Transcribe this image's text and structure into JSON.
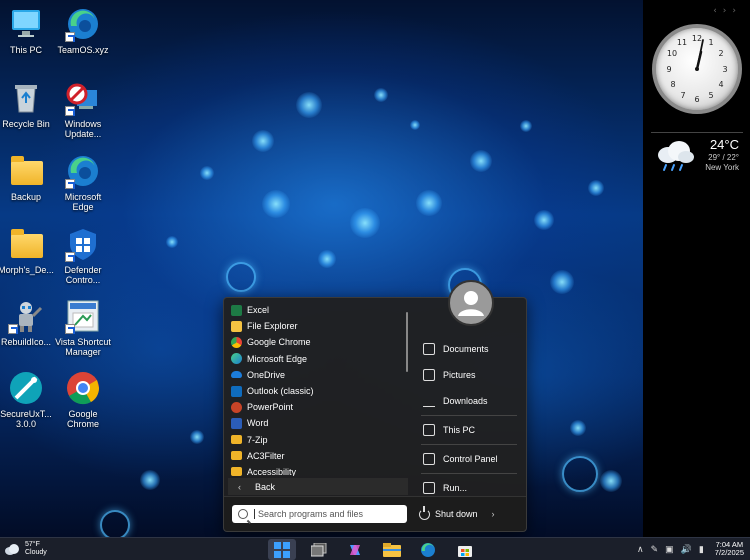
{
  "desktop_icons": [
    {
      "label": "This PC",
      "icon": "this-pc-icon"
    },
    {
      "label": "TeamOS.xyz",
      "icon": "edge-icon"
    },
    {
      "label": "Recycle Bin",
      "icon": "recycle-bin-icon"
    },
    {
      "label": "Windows Update...",
      "icon": "windows-update-icon"
    },
    {
      "label": "Backup",
      "icon": "folder-icon"
    },
    {
      "label": "Microsoft Edge",
      "icon": "edge-icon"
    },
    {
      "label": "Morph's_De...",
      "icon": "folder-icon"
    },
    {
      "label": "Defender Contro...",
      "icon": "defender-icon"
    },
    {
      "label": "RebuildIco...",
      "icon": "robot-icon"
    },
    {
      "label": "Vista Shortcut Manager",
      "icon": "shortcut-manager-icon"
    },
    {
      "label": "SecureUxT... 3.0.0",
      "icon": "secureux-icon"
    },
    {
      "label": "Google Chrome",
      "icon": "chrome-icon"
    }
  ],
  "sidebar": {
    "clock_time": "7:04",
    "weather": {
      "temp": "24°C",
      "range": "29° / 22°",
      "city": "New York",
      "icon": "rain-cloud-icon"
    }
  },
  "start_menu": {
    "programs": [
      {
        "label": "Excel",
        "icon": "excel-icon",
        "color": "#1d7a45"
      },
      {
        "label": "File Explorer",
        "icon": "file-explorer-icon",
        "color": "#f5c242"
      },
      {
        "label": "Google Chrome",
        "icon": "chrome-icon",
        "color": "#ea4335"
      },
      {
        "label": "Microsoft Edge",
        "icon": "edge-icon",
        "color": "#1ba5d8"
      },
      {
        "label": "OneDrive",
        "icon": "onedrive-icon",
        "color": "#1c7ddb"
      },
      {
        "label": "Outlook (classic)",
        "icon": "outlook-icon",
        "color": "#0f6cbd"
      },
      {
        "label": "PowerPoint",
        "icon": "powerpoint-icon",
        "color": "#c84427"
      },
      {
        "label": "Word",
        "icon": "word-icon",
        "color": "#2b5db8"
      },
      {
        "label": "7-Zip",
        "icon": "folder-icon",
        "color": "#f0b429"
      },
      {
        "label": "AC3Filter",
        "icon": "folder-icon",
        "color": "#f0b429"
      },
      {
        "label": "Accessibility",
        "icon": "folder-icon",
        "color": "#f0b429"
      }
    ],
    "back_label": "Back",
    "right_items": [
      {
        "label": "Documents",
        "icon": "documents-icon"
      },
      {
        "label": "Pictures",
        "icon": "pictures-icon"
      },
      {
        "label": "Downloads",
        "icon": "downloads-icon"
      },
      {
        "label": "This PC",
        "icon": "this-pc-icon"
      },
      {
        "label": "Control Panel",
        "icon": "control-panel-icon"
      },
      {
        "label": "Run...",
        "icon": "run-icon"
      }
    ],
    "search_placeholder": "Search programs and files",
    "shutdown_label": "Shut down"
  },
  "taskbar": {
    "weather_temp": "57°F",
    "weather_desc": "Cloudy",
    "time": "7:04 AM",
    "date": "7/2/2025",
    "tray_icons": [
      "chevron-up-icon",
      "pen-icon",
      "network-icon",
      "volume-icon",
      "battery-icon"
    ]
  }
}
